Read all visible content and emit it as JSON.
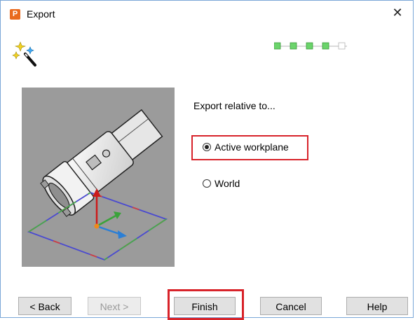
{
  "window": {
    "title": "Export",
    "app_icon_letter": "P",
    "close_glyph": "✕"
  },
  "wizard": {
    "icon": "magic-wand-icon",
    "step_indicator": {
      "total": 5,
      "completed": 4
    }
  },
  "content": {
    "export_label": "Export relative to...",
    "options": [
      {
        "label": "Active workplane",
        "selected": true
      },
      {
        "label": "World",
        "selected": false
      }
    ],
    "preview_image": "part-with-workplane-axes"
  },
  "buttons": {
    "back": "< Back",
    "next": "Next >",
    "finish": "Finish",
    "cancel": "Cancel",
    "help": "Help"
  },
  "colors": {
    "highlight": "#d8232a",
    "step_complete": "#6bd46b",
    "app_icon": "#e96a1e",
    "preview_bg": "#9b9b9b"
  }
}
